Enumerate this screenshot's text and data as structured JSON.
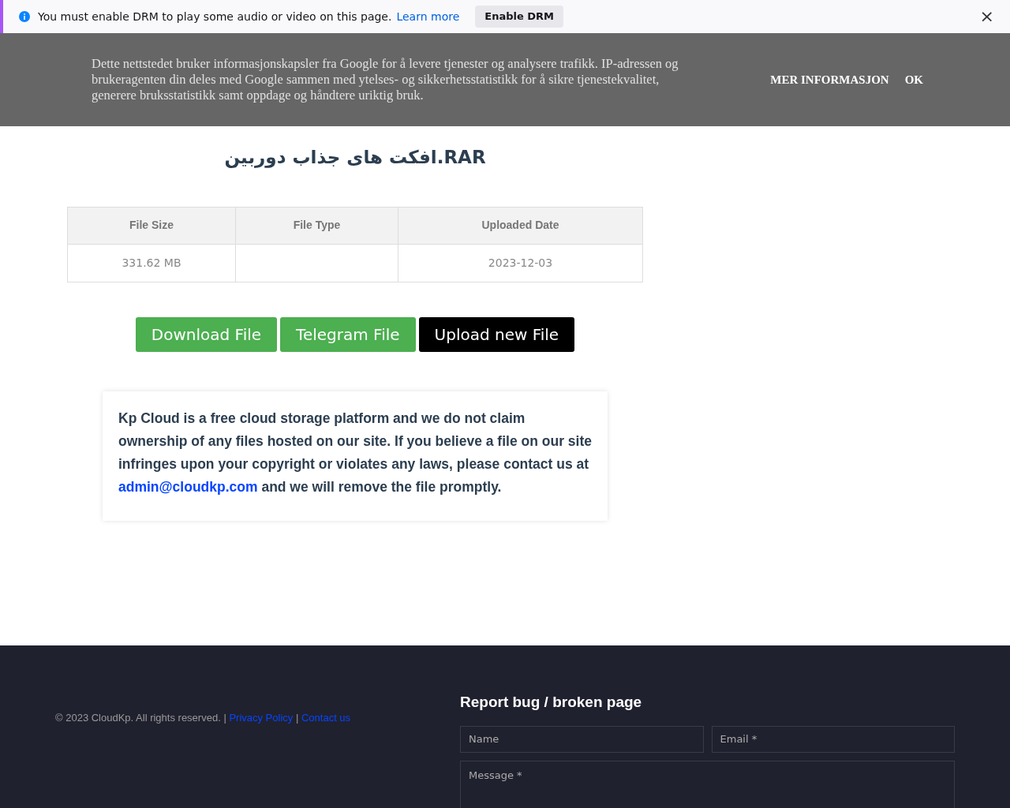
{
  "drm_bar": {
    "message": "You must enable DRM to play some audio or video on this page.",
    "link": "Learn more",
    "button": "Enable DRM",
    "close": "×"
  },
  "cookie_banner": {
    "text": "Dette nettstedet bruker informasjonskapsler fra Google for å levere tjenester og analysere trafikk. IP-adressen og brukeragenten din deles med Google sammen med ytelses- og sikkerhetsstatistikk for å sikre tjenestekvalitet, generere bruksstatistikk samt oppdage og håndtere uriktig bruk.",
    "buttons": [
      "MER INFORMASJON",
      "OK"
    ]
  },
  "file": {
    "title": "افکت های جذاب دوربین.RAR",
    "table": {
      "columns": [
        "File Size",
        "File Type",
        "Uploaded Date"
      ],
      "rows": [
        [
          "331.62 MB",
          "",
          "2023-12-03"
        ]
      ]
    },
    "buttons": [
      {
        "label": "Download File",
        "kind": "green"
      },
      {
        "label": "Telegram File",
        "kind": "green"
      },
      {
        "label": "Upload new File",
        "kind": "black"
      }
    ]
  },
  "disclaimer": {
    "before": "Kp Cloud is a free cloud storage platform and we do not claim ownership of any files hosted on our site. If you believe a file on our site infringes upon your copyright or violates any laws, please contact us at ",
    "link": "admin@cloudkp.com",
    "after": " and we will remove the file promptly."
  },
  "footer": {
    "copyright": "© 2023 CloudKp. All rights reserved.",
    "separator": "|",
    "links": [
      "Privacy Policy",
      "Contact us"
    ],
    "report": {
      "title": "Report bug / broken page",
      "fields": [
        {
          "placeholder": "Name"
        },
        {
          "placeholder": "Email *"
        }
      ],
      "message_placeholder": "Message *"
    }
  }
}
